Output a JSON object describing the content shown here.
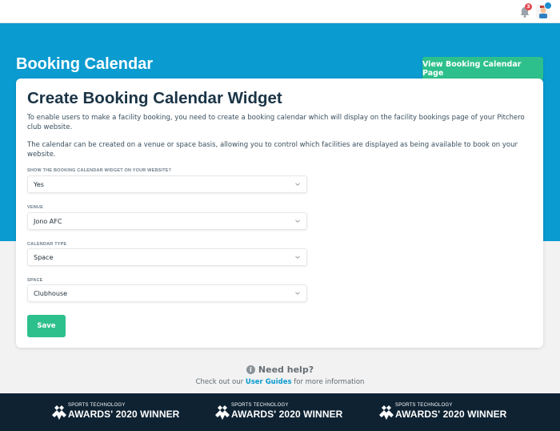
{
  "header": {
    "notification_count": "3"
  },
  "hero": {
    "title": "Booking Calendar",
    "view_button_label": "View Booking Calendar Page"
  },
  "card": {
    "title": "Create Booking Calendar Widget",
    "intro_paragraph_1": "To enable users to make a facility booking, you need to create a booking calendar which will display on the facility bookings page of your Pitchero club website.",
    "intro_paragraph_2": "The calendar can be created on a venue or space basis, allowing you to control which facilities are displayed as being available to book on your website.",
    "fields": [
      {
        "label": "SHOW THE BOOKING CALENDAR WIDGET ON YOUR WEBSITE?",
        "value": "Yes"
      },
      {
        "label": "VENUE",
        "value": "Jono AFC"
      },
      {
        "label": "CALENDAR TYPE",
        "value": "Space"
      },
      {
        "label": "SPACE",
        "value": "Clubhouse"
      }
    ],
    "save_label": "Save"
  },
  "help": {
    "title": "Need help?",
    "text_before": "Check out our ",
    "link": "User Guides",
    "text_after": " for more information"
  },
  "footer": {
    "awards": [
      {
        "small": "SPORTS TECHNOLOGY",
        "big": "AWARDS' 2020 WINNER"
      },
      {
        "small": "SPORTS TECHNOLOGY",
        "big": "AWARDS' 2020 WINNER"
      },
      {
        "small": "SPORTS TECHNOLOGY",
        "big": "AWARDS' 2020 WINNER"
      }
    ]
  },
  "colors": {
    "brand_blue": "#0a9bd0",
    "accent_green": "#2ec08c",
    "footer_navy": "#0e2232"
  },
  "icons": [
    "bell-icon",
    "avatar-icon",
    "chevron-down-icon",
    "info-icon",
    "award-logo-icon"
  ]
}
